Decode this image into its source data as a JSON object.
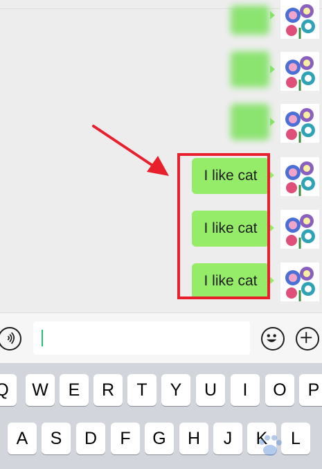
{
  "chat": {
    "messages": [
      {
        "text": "I like cat"
      },
      {
        "text": "I like cat"
      },
      {
        "text": "I like cat"
      }
    ]
  },
  "input_bar": {
    "voice_icon": "voice-icon",
    "emoji_icon": "emoji-icon",
    "plus_icon": "plus-icon"
  },
  "keyboard": {
    "row1": [
      "Q",
      "W",
      "E",
      "R",
      "T",
      "Y",
      "U",
      "I",
      "O",
      "P"
    ],
    "row2": [
      "A",
      "S",
      "D",
      "F",
      "G",
      "H",
      "J",
      "K",
      "L"
    ]
  },
  "colors": {
    "bubble": "#95ec69",
    "highlight": "#e8202b",
    "background": "#ededed"
  }
}
